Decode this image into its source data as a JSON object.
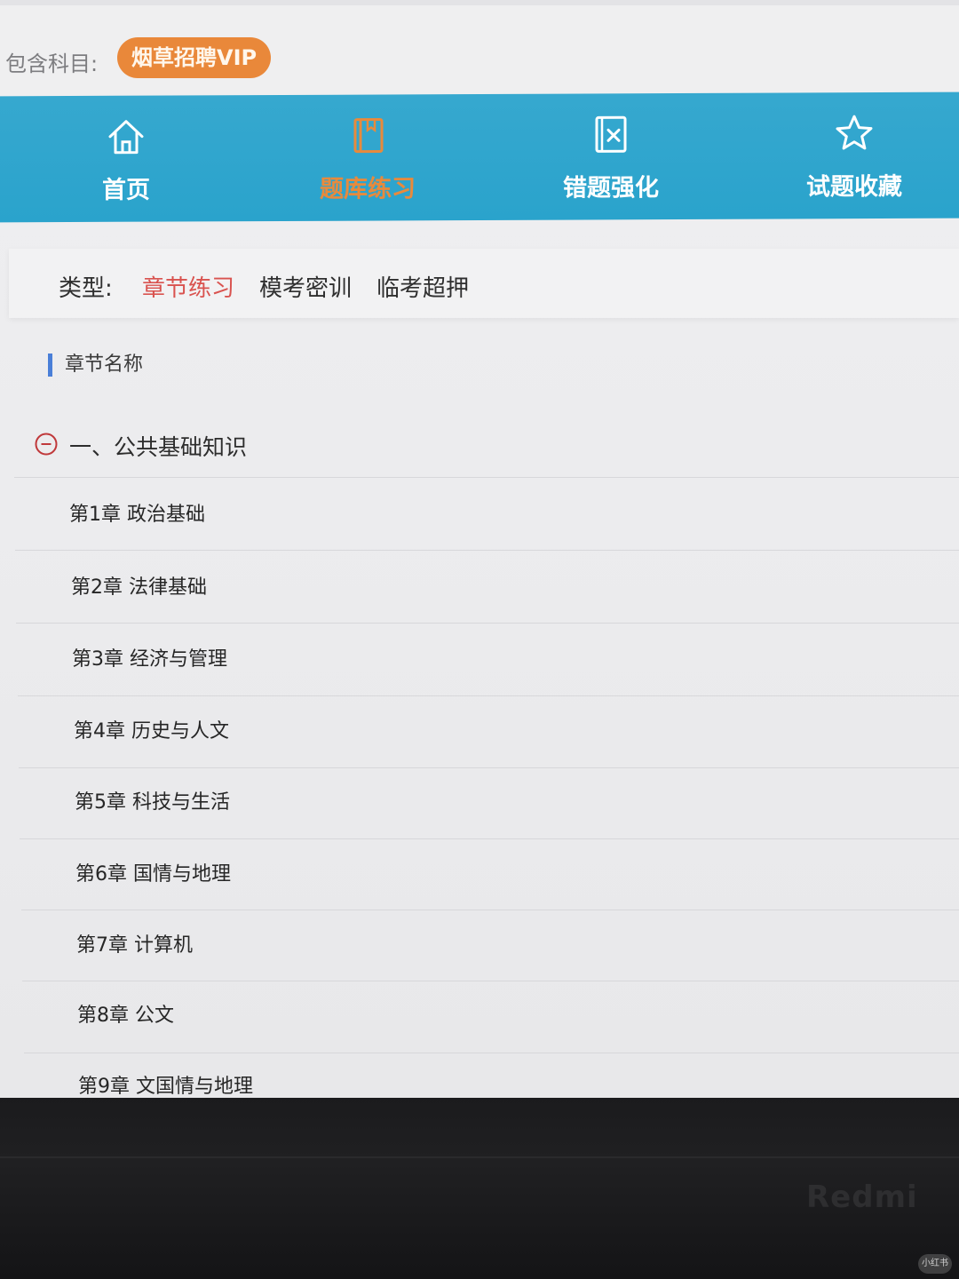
{
  "subject": {
    "label": "包含科目:",
    "tag": "烟草招聘VIP"
  },
  "nav": {
    "items": [
      {
        "label": "首页",
        "icon": "home-icon",
        "active": false
      },
      {
        "label": "题库练习",
        "icon": "book-icon",
        "active": true
      },
      {
        "label": "错题强化",
        "icon": "wrong-question-icon",
        "active": false
      },
      {
        "label": "试题收藏",
        "icon": "star-icon",
        "active": false
      }
    ]
  },
  "type_filter": {
    "label": "类型:",
    "options": [
      "章节练习",
      "模考密训",
      "临考超押"
    ],
    "selected": "章节练习"
  },
  "section": {
    "title": "章节名称"
  },
  "group": {
    "title": "一、公共基础知识",
    "chapters": [
      "第1章 政治基础",
      "第2章 法律基础",
      "第3章 经济与管理",
      "第4章 历史与人文",
      "第5章 科技与生活",
      "第6章 国情与地理",
      "第7章 计算机",
      "第8章 公文",
      "第9章 文国情与地理"
    ]
  },
  "device": {
    "brand": "Redmi"
  },
  "watermark": "小红书",
  "colors": {
    "nav_bg": "#2aa3cc",
    "accent_orange": "#e9883a",
    "selected_red": "#d9534f",
    "section_bar": "#4a7fd8"
  }
}
